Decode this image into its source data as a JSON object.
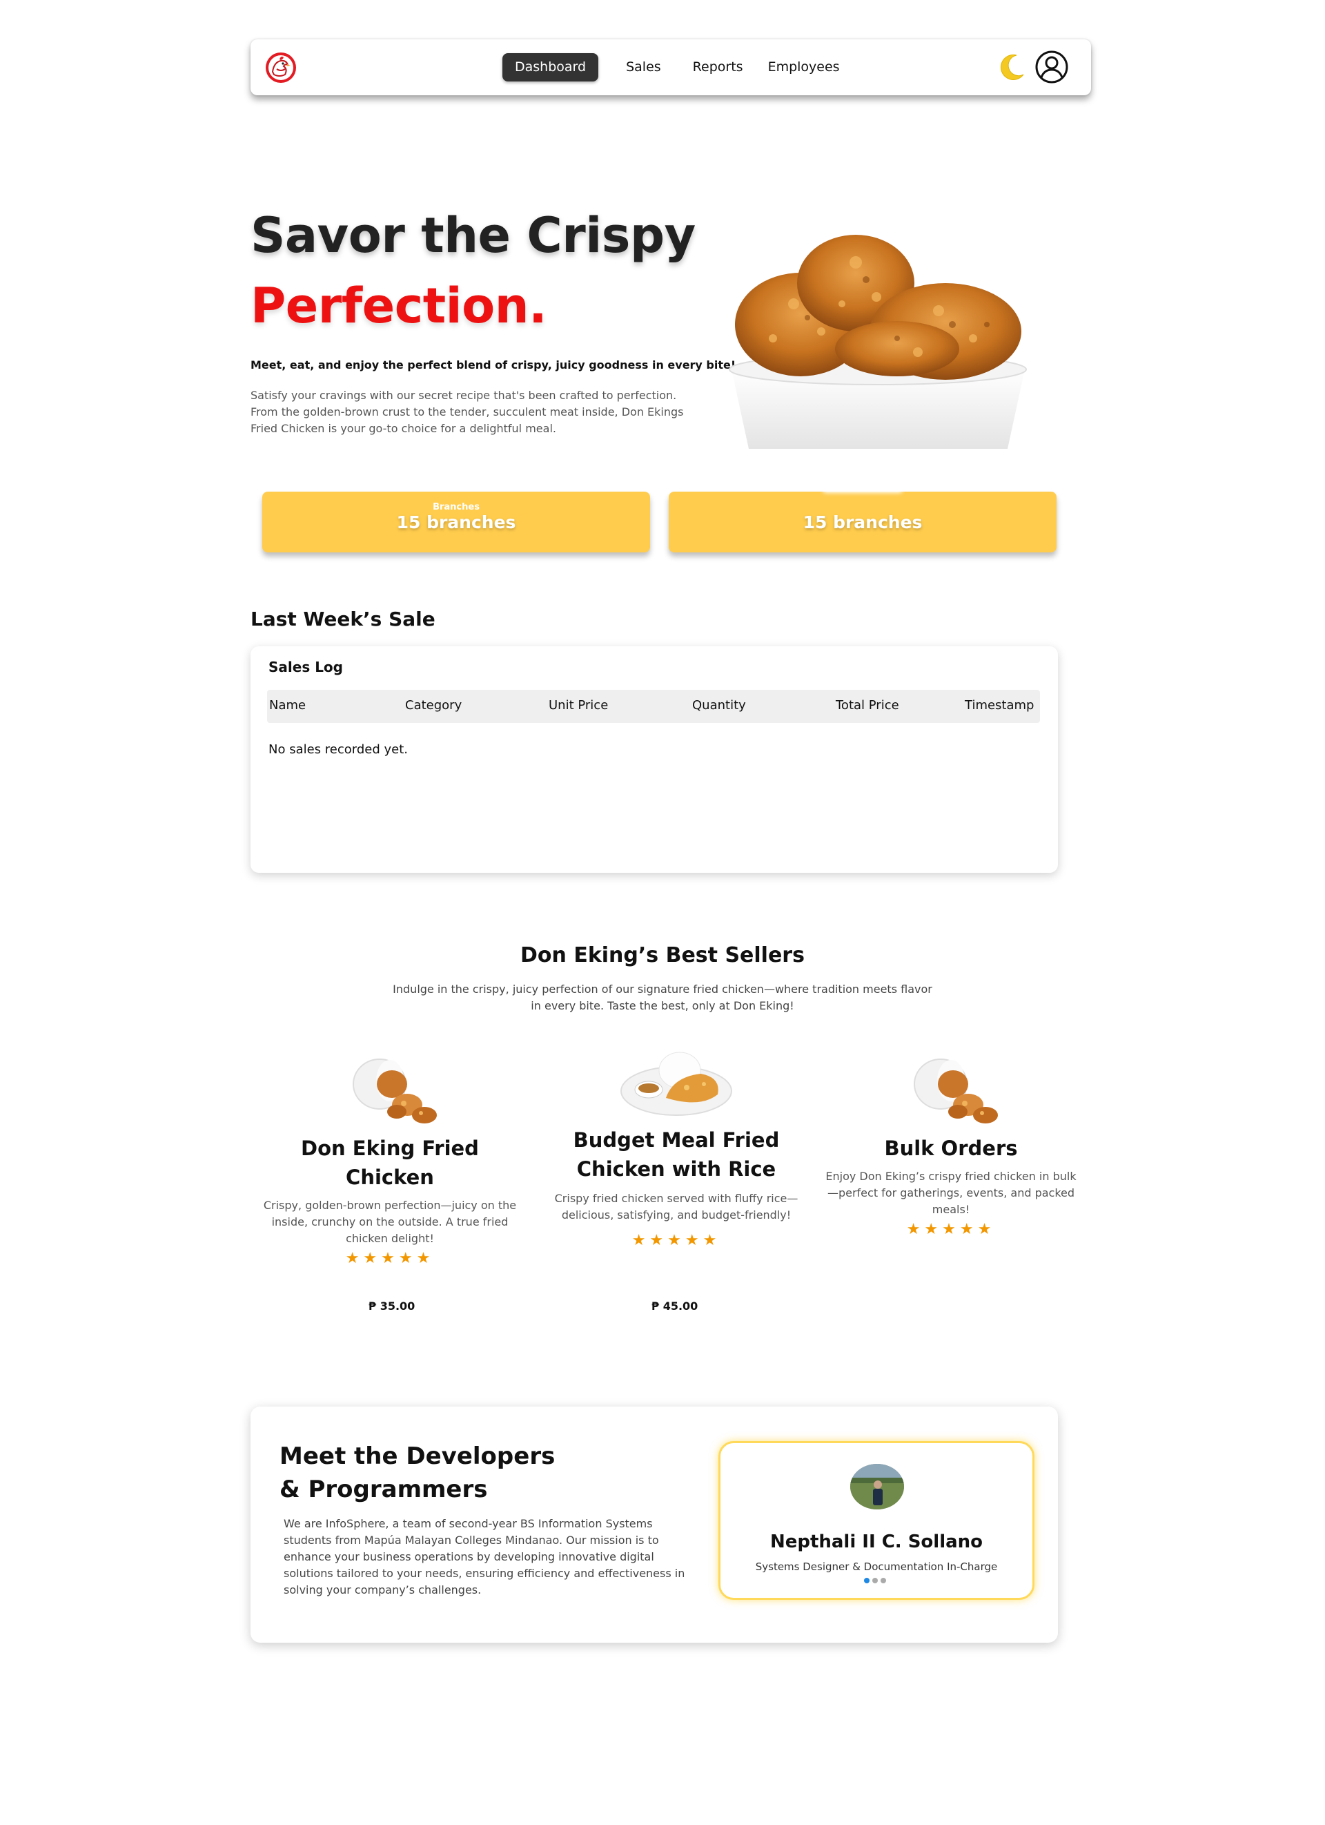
{
  "nav": {
    "links": [
      "Dashboard",
      "Sales",
      "Reports",
      "Employees"
    ],
    "active": "Dashboard",
    "brand_color": "#e31b23",
    "icons": [
      "logo-icon",
      "moon-icon",
      "user-icon"
    ]
  },
  "hero": {
    "title_line1": "Savor the Crispy",
    "title_line2": "Perfection.",
    "tagline": "Meet, eat, and enjoy the perfect blend of crispy, juicy goodness in every bite!",
    "description": "Satisfy your cravings with our secret recipe that's been crafted to perfection. From the golden-brown crust to the tender, succulent meat inside, Don Ekings Fried Chicken is your go-to choice for a delightful meal."
  },
  "stats": {
    "left": {
      "label": "Branches",
      "value": "15 branches"
    },
    "right": {
      "value": "15 branches"
    },
    "color": "#ffcc4d"
  },
  "sales": {
    "section_title": "Last Week’s Sale",
    "card_title": "Sales Log",
    "columns": [
      "Name",
      "Category",
      "Unit Price",
      "Quantity",
      "Total Price",
      "Timestamp"
    ],
    "empty_message": "No sales recorded yet."
  },
  "best_sellers": {
    "title": "Don Eking’s Best Sellers",
    "description": "Indulge in the crispy, juicy perfection of our signature fried chicken—where tradition meets flavor in every bite. Taste the best, only at Don Eking!",
    "products": [
      {
        "name": "Don Eking Fried Chicken",
        "description": "Crispy, golden-brown perfection—juicy on the inside, crunchy on the outside. A true fried chicken delight!",
        "stars": "★★★★★",
        "price": "₱ 35.00"
      },
      {
        "name": "Budget Meal Fried Chicken with Rice",
        "description": "Crispy fried chicken served with fluffy rice—delicious, satisfying, and budget-friendly!",
        "stars": "★★★★★",
        "price": "₱ 45.00"
      },
      {
        "name": "Bulk Orders",
        "description": "Enjoy Don Eking’s crispy fried chicken in bulk—perfect for gatherings, events, and packed meals!",
        "stars": "★★★★★",
        "price": ""
      }
    ],
    "star_color": "#f29700"
  },
  "developers": {
    "title": "Meet the Developers & Programmers",
    "description": "We are InfoSphere, a team of second-year BS Information Systems students from Mapúa Malayan Colleges Mindanao. Our mission is to enhance your business operations by developing innovative digital solutions tailored to your needs, ensuring efficiency and effectiveness in solving your company’s challenges.",
    "profile": {
      "name": "Nepthali II C. Sollano",
      "role": "Systems Designer & Documentation In-Charge"
    },
    "carousel": {
      "count": 3,
      "active_index": 0
    }
  }
}
